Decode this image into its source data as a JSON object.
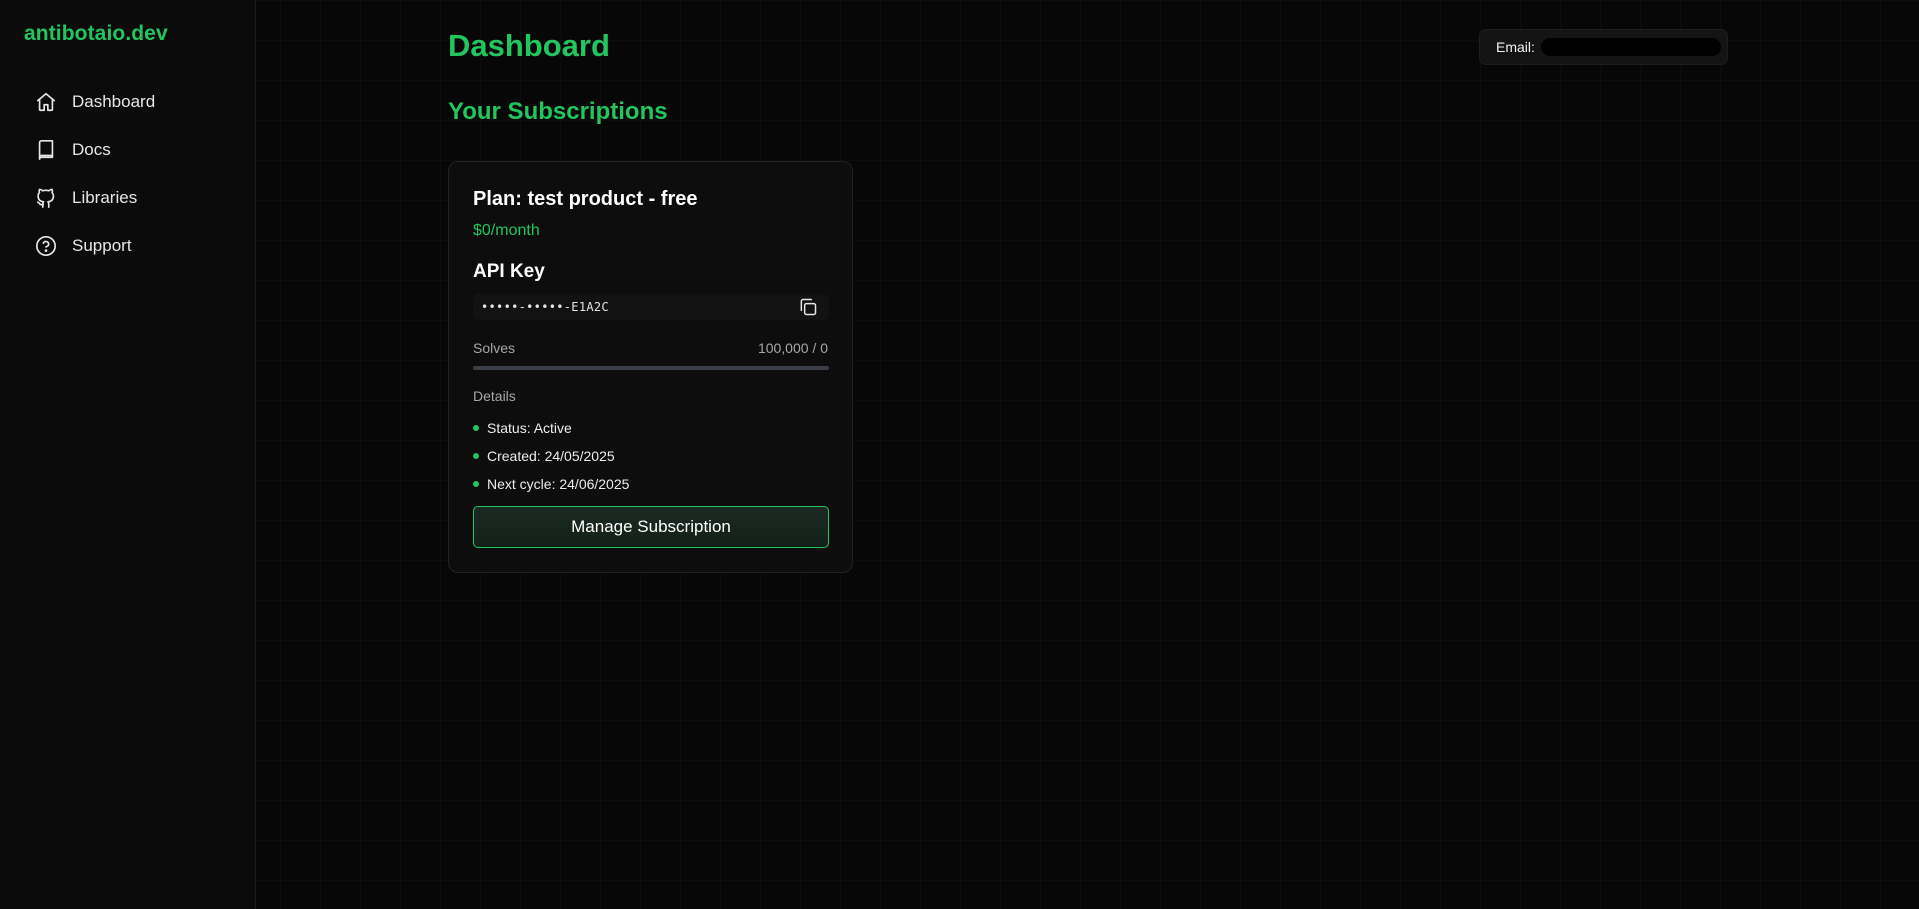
{
  "sidebar": {
    "brand": "antibotaio.dev",
    "items": [
      {
        "label": "Dashboard",
        "icon": "home-icon"
      },
      {
        "label": "Docs",
        "icon": "book-icon"
      },
      {
        "label": "Libraries",
        "icon": "github-icon"
      },
      {
        "label": "Support",
        "icon": "help-circle-icon"
      }
    ]
  },
  "header": {
    "title": "Dashboard",
    "email_label": "Email:",
    "email_value_redacted": true
  },
  "main": {
    "section_title": "Your Subscriptions",
    "subscription": {
      "plan_title": "Plan: test product - free",
      "price": "$0/month",
      "api_key_label": "API Key",
      "api_key_value": "•••••-•••••-E1A2C",
      "solves_label": "Solves",
      "solves_value": "100,000 / 0",
      "solves_progress_fraction": 0,
      "details_label": "Details",
      "details": [
        "Status: Active",
        "Created: 24/05/2025",
        "Next cycle: 24/06/2025"
      ],
      "manage_button_label": "Manage Subscription"
    }
  },
  "colors": {
    "accent": "#22c55e",
    "background": "#070707",
    "sidebar_bg": "#0b0b0b",
    "card_bg": "#0d0d0d"
  }
}
